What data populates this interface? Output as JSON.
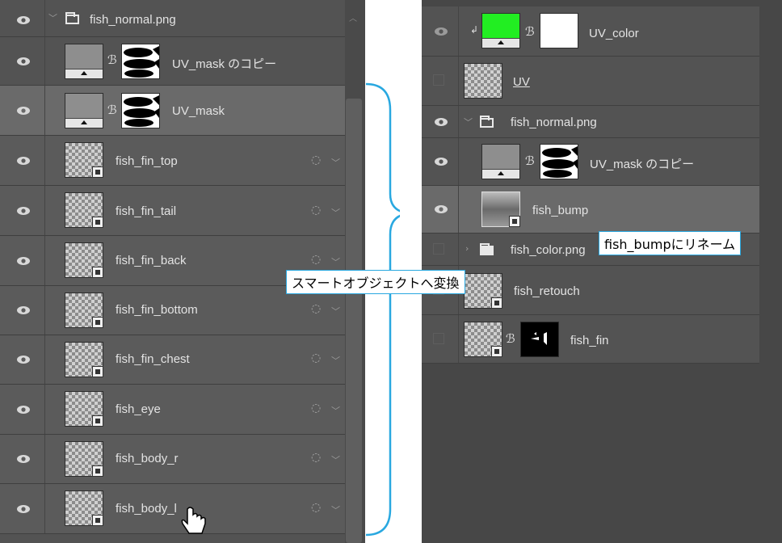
{
  "left_panel": {
    "group": {
      "name": "fish_normal.png"
    },
    "mask_copy_layer": {
      "name": "UV_mask のコピー"
    },
    "mask_layer": {
      "name": "UV_mask"
    },
    "layers": [
      {
        "name": "fish_fin_top"
      },
      {
        "name": "fish_fin_tail"
      },
      {
        "name": "fish_fin_back"
      },
      {
        "name": "fish_fin_bottom"
      },
      {
        "name": "fish_fin_chest"
      },
      {
        "name": "fish_eye"
      },
      {
        "name": "fish_body_r"
      },
      {
        "name": "fish_body_l"
      }
    ],
    "fx_icon": "smart-filter-icon",
    "expand_icon": "chevron-down-icon"
  },
  "right_panel": {
    "layers": {
      "uv_color": {
        "name": "UV_color"
      },
      "uv": {
        "name": "UV"
      },
      "group_normal": {
        "name": "fish_normal.png"
      },
      "uv_mask_copy": {
        "name": "UV_mask のコピー"
      },
      "fish_bump": {
        "name": "fish_bump"
      },
      "group_color": {
        "name": "fish_color.png"
      },
      "fish_retouch": {
        "name": "fish_retouch"
      },
      "fish_fin": {
        "name": "fish_fin"
      }
    }
  },
  "annotations": {
    "convert_smart_object": "スマートオブジェクトへ変換",
    "rename_note": "fish_bumpにリネーム"
  },
  "colors": {
    "panel_bg": "#535353",
    "selected_row": "#6a6a6a",
    "brace": "#29a8e0",
    "uv_color_swatch": "#22ee22"
  }
}
